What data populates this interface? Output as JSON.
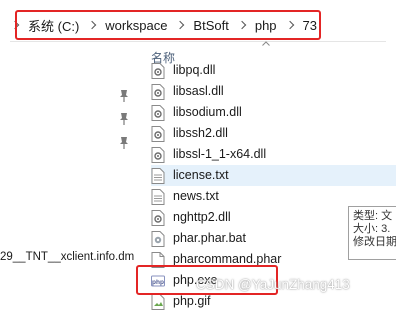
{
  "breadcrumb": {
    "segments": [
      "系统 (C:)",
      "workspace",
      "BtSoft",
      "php",
      "73"
    ]
  },
  "file_list": {
    "column_header": "名称",
    "files": [
      {
        "name": "libpq.dll",
        "icon": "dll-icon"
      },
      {
        "name": "libsasl.dll",
        "icon": "dll-icon"
      },
      {
        "name": "libsodium.dll",
        "icon": "dll-icon"
      },
      {
        "name": "libssh2.dll",
        "icon": "dll-icon"
      },
      {
        "name": "libssl-1_1-x64.dll",
        "icon": "dll-icon"
      },
      {
        "name": "license.txt",
        "icon": "text-file-icon",
        "selected": true
      },
      {
        "name": "news.txt",
        "icon": "text-file-icon"
      },
      {
        "name": "nghttp2.dll",
        "icon": "dll-icon"
      },
      {
        "name": "phar.phar.bat",
        "icon": "batch-file-icon"
      },
      {
        "name": "pharcommand.phar",
        "icon": "generic-file-icon"
      },
      {
        "name": "php.exe",
        "icon": "php-exe-icon"
      },
      {
        "name": "php.gif",
        "icon": "image-file-icon"
      }
    ]
  },
  "left_pane": {
    "file_label": "29__TNT__xclient.info.dm"
  },
  "tooltip": {
    "lines": [
      "类型: 文",
      "大小: 3.",
      "修改日期"
    ]
  },
  "watermark": "CSDN @YaJunZhang413",
  "colors": {
    "highlight": "#e32525",
    "selection": "#e5f1fb",
    "header_text": "#4c607a"
  }
}
